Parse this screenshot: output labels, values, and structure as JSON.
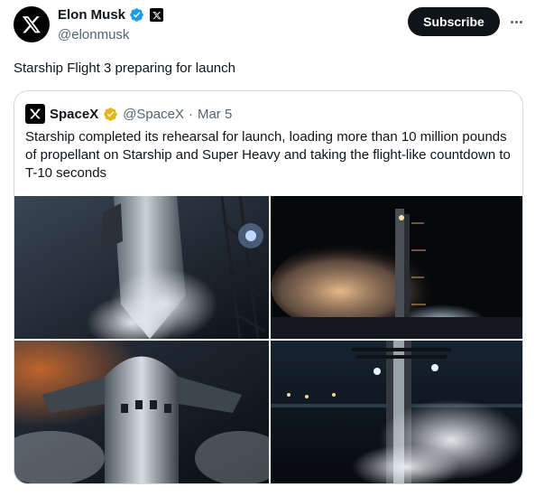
{
  "author": {
    "display_name": "Elon Musk",
    "handle": "@elonmusk",
    "avatar_icon": "x-logo-icon",
    "verified_icon": "blue-verified-icon",
    "affiliate_icon": "x-affiliate-icon"
  },
  "actions": {
    "subscribe_label": "Subscribe",
    "more_icon": "more-horizontal-icon"
  },
  "tweet": {
    "text": "Starship Flight 3 preparing for launch"
  },
  "quote": {
    "display_name": "SpaceX",
    "handle": "@SpaceX",
    "separator": "·",
    "date": "Mar 5",
    "verified_icon": "gold-verified-icon",
    "text": "Starship completed its rehearsal for launch, loading more than 10 million pounds of propellant on Starship and Super Heavy and taking the flight-like countdown to T-10 seconds"
  },
  "colors": {
    "text_primary": "#0f1419",
    "text_secondary": "#536471",
    "verified_blue": "#1d9bf0",
    "verified_gold": "#e2b719",
    "border": "#cfd9de"
  }
}
